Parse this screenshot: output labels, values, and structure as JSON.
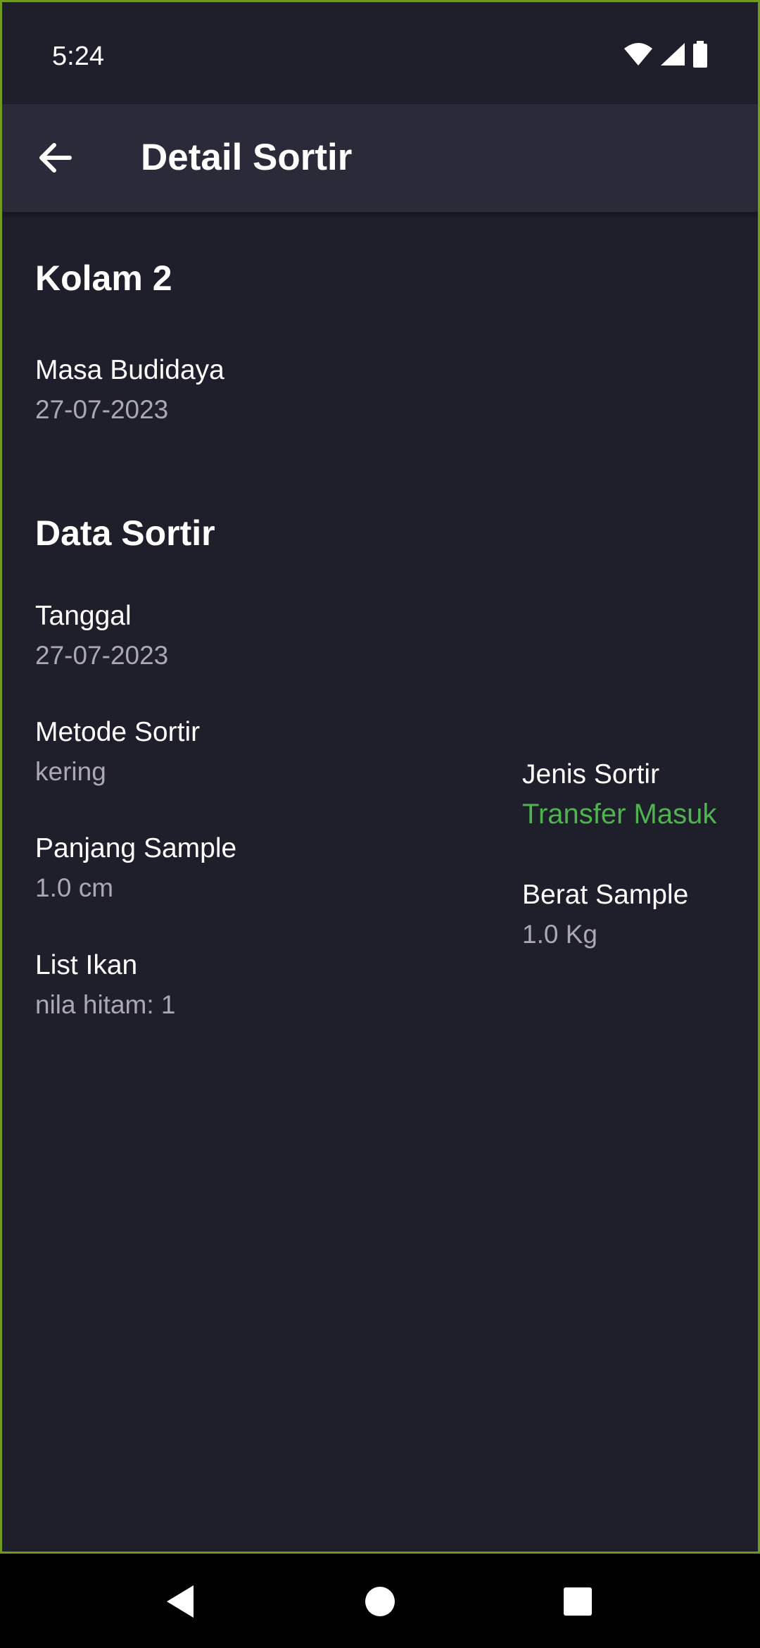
{
  "status_bar": {
    "time": "5:24",
    "icons": [
      "wifi-icon",
      "signal-icon",
      "battery-icon"
    ]
  },
  "app_bar": {
    "back_icon": "arrow-left-icon",
    "title": "Detail Sortir"
  },
  "pond": {
    "name": "Kolam 2",
    "masa_budidaya_label": "Masa Budidaya",
    "masa_budidaya_value": "27-07-2023"
  },
  "sortir": {
    "section_title": "Data Sortir",
    "tanggal_label": "Tanggal",
    "tanggal_value": "27-07-2023",
    "metode_label": "Metode Sortir",
    "metode_value": "kering",
    "jenis_label": "Jenis Sortir",
    "jenis_value": "Transfer Masuk",
    "panjang_label": "Panjang Sample",
    "panjang_value": "1.0 cm",
    "berat_label": "Berat Sample",
    "berat_value": "1.0 Kg",
    "list_label": "List Ikan",
    "list_value": "nila hitam: 1"
  },
  "colors": {
    "background": "#1f1e2b",
    "app_bar": "#2b2a38",
    "accent_green": "#4fb34f",
    "muted_text": "#a9a8b3",
    "frame_border": "#6f9a1c"
  },
  "nav_bar": {
    "back": "nav-back-icon",
    "home": "nav-home-icon",
    "recents": "nav-recents-icon"
  }
}
